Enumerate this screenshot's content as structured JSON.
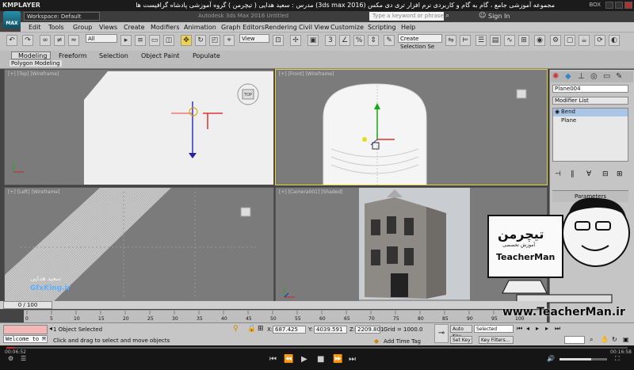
{
  "player": {
    "logo": "KMPLAYER",
    "title": "مجموعه آموزشی جامع ، گام به گام و کاربردی نرم افزار تری دی مکس (3ds max 2016) مدرس : سعید هدایی ( تیچرمن ) گروه آموزشی پادشاه گرافیست ها",
    "box": "BOX",
    "time_current": "00:06:52",
    "time_total": "00:16:58"
  },
  "max": {
    "logo": "MAX",
    "workspace": "Workspace: Default",
    "title": "Autodesk 3ds Max 2016     Untitled",
    "search_placeholder": "Type a keyword or phrase",
    "signin": "Sign In"
  },
  "menu": [
    "Edit",
    "Tools",
    "Group",
    "Views",
    "Create",
    "Modifiers",
    "Animation",
    "Graph Editors",
    "Rendering",
    "Civil View",
    "Customize",
    "Scripting",
    "Help"
  ],
  "toolbar": {
    "filter": "All",
    "refcoord": "View",
    "selset": "Create Selection Se"
  },
  "ribbon": {
    "tabs": [
      "Modeling",
      "Freeform",
      "Selection",
      "Object Paint",
      "Populate"
    ],
    "sub_label": "Polygon Modeling"
  },
  "viewports": {
    "top": "[+] [Top] [Wireframe]",
    "front": "[+] [Front] [Wireframe]",
    "left": "[+] [Left] [Wireframe]",
    "camera": "[+] [Camera001] [Shaded]",
    "viewcube_top": "TOP",
    "left_watermark": "GfxKing.ir",
    "left_watermark_fa": "سعید هدایی"
  },
  "command_panel": {
    "object_name": "Plane004",
    "modifier_list": "Modifier List",
    "stack": [
      "Bend",
      "Plane"
    ],
    "parameters": "Parameters"
  },
  "teacher": {
    "name": "TeacherMan",
    "fa_name": "تیچرمن",
    "fa_sub": "آموزش تخصصی"
  },
  "timeline": {
    "frame": "0 / 100",
    "ticks": [
      "0",
      "5",
      "10",
      "15",
      "20",
      "25",
      "30",
      "35",
      "40",
      "45",
      "50",
      "55",
      "60",
      "65",
      "70",
      "75",
      "80",
      "85",
      "90",
      "95",
      "100"
    ]
  },
  "status": {
    "listener": "Welcome to M",
    "selection": "1 Object Selected",
    "hint": "Click and drag to select and move objects",
    "x_label": "X:",
    "x": "687.425",
    "y_label": "Y:",
    "y": "4039.591",
    "z_label": "Z:",
    "z": "2209.801",
    "grid": "Grid = 1000.0",
    "add_time_tag": "Add Time Tag",
    "auto_key": "Auto Key",
    "set_key": "Set Key",
    "selected": "Selected",
    "key_filters": "Key Filters..."
  },
  "watermark": "www.TeacherMan.ir"
}
